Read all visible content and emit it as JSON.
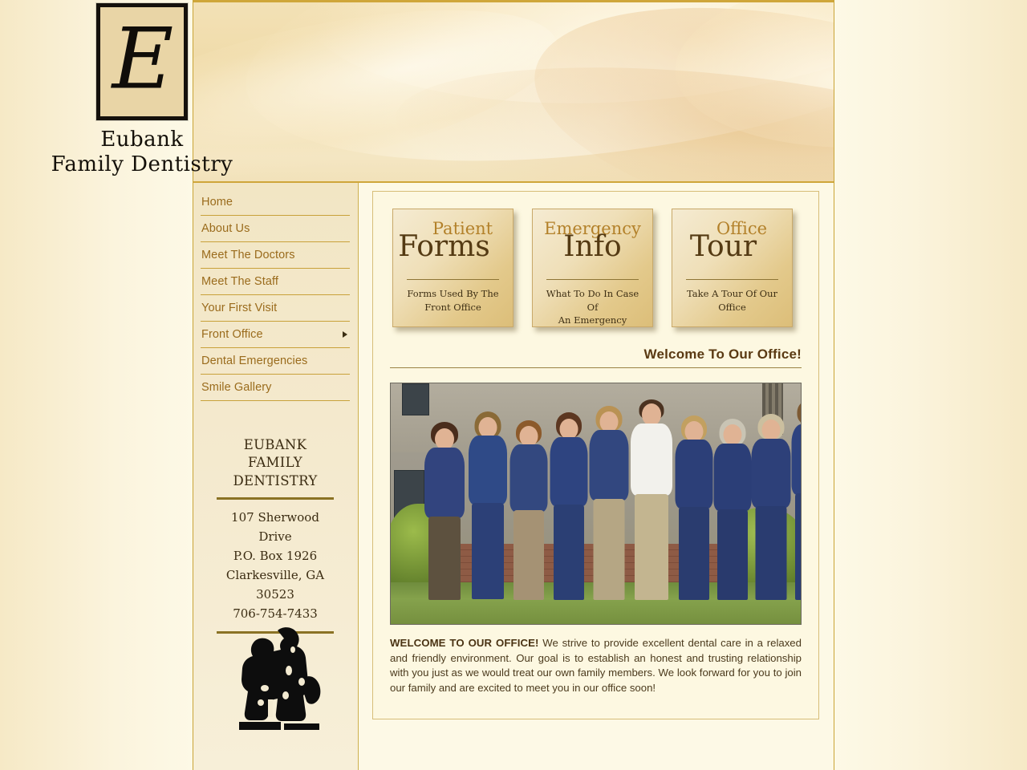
{
  "site": {
    "logo_letter": "E",
    "logo_line1": "Eubank",
    "logo_line2": "Family Dentistry"
  },
  "nav": {
    "items": [
      {
        "label": "Home",
        "has_submenu": false
      },
      {
        "label": "About Us",
        "has_submenu": false
      },
      {
        "label": "Meet The Doctors",
        "has_submenu": false
      },
      {
        "label": "Meet The Staff",
        "has_submenu": false
      },
      {
        "label": "Your First Visit",
        "has_submenu": false
      },
      {
        "label": "Front Office",
        "has_submenu": true
      },
      {
        "label": "Dental Emergencies",
        "has_submenu": false
      },
      {
        "label": "Smile Gallery",
        "has_submenu": false
      }
    ]
  },
  "address": {
    "title_line1": "EUBANK FAMILY",
    "title_line2": "DENTISTRY",
    "street": "107 Sherwood Drive",
    "po_box": "P.O. Box 1926",
    "city_state_zip": "Clarkesville, GA 30523",
    "phone": "706-754-7433"
  },
  "cards": [
    {
      "small": "Patient",
      "big": "Forms",
      "sub_line1": "Forms Used By The",
      "sub_line2": "Front Office"
    },
    {
      "small": "Emergency",
      "big": "Info",
      "sub_line1": "What To Do In Case Of",
      "sub_line2": "An Emergency"
    },
    {
      "small": "Office",
      "big": "Tour",
      "sub_line1": "Take A Tour Of Our",
      "sub_line2": "Office"
    }
  ],
  "main": {
    "welcome_heading": "Welcome To Our Office!",
    "photo_alt": "Dental practice team photo outside office building",
    "body_lead": "WELCOME TO OUR OFFICE!",
    "body_text": " We strive to provide excellent dental care in a relaxed and friendly environment. Our goal is to establish an honest and trusting relationship with you just as we would treat our own family members. We look forward for you to join our family and are excited to meet you in our office soon!"
  },
  "decor": {
    "figurine_alt": "silhouette of two children figurine"
  },
  "colors": {
    "header_gold": "#cfa63a",
    "nav_link": "#9a6b1c",
    "heading_brown": "#5a3a13",
    "card_big": "#543a13",
    "card_small": "#b3812a",
    "body": "#4b3a1d",
    "sidebar_bg": "#f2e6c4",
    "content_bg": "#fdf8e1"
  }
}
